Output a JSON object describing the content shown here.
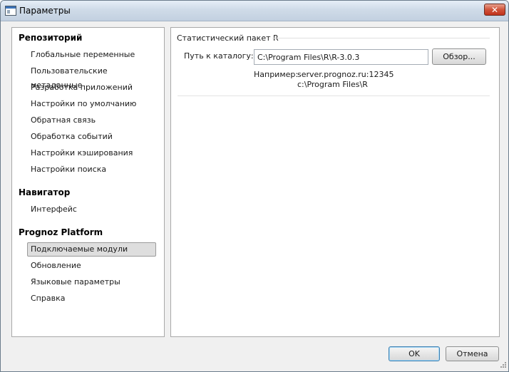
{
  "window": {
    "title": "Параметры",
    "close_glyph": "✕",
    "icon": "app-window-icon"
  },
  "sidebar": {
    "categories": [
      {
        "title": "Репозиторий",
        "items": [
          {
            "label": "Глобальные переменные"
          },
          {
            "label": "Пользовательские метаданные"
          },
          {
            "label": "Разработка приложений"
          },
          {
            "label": "Настройки по умолчанию"
          },
          {
            "label": "Обратная связь"
          },
          {
            "label": "Обработка событий"
          },
          {
            "label": "Настройки кэширования"
          },
          {
            "label": "Настройки поиска"
          }
        ]
      },
      {
        "title": "Навигатор",
        "items": [
          {
            "label": "Интерфейс"
          }
        ]
      },
      {
        "title": "Prognoz Platform",
        "items": [
          {
            "label": "Подключаемые модули",
            "selected": true
          },
          {
            "label": "Обновление"
          },
          {
            "label": "Языковые параметры"
          },
          {
            "label": "Справка"
          }
        ]
      }
    ]
  },
  "content": {
    "group_title": "Статистический пакет R",
    "path_label": "Путь к каталогу:",
    "path_value": "C:\\Program Files\\R\\R-3.0.3",
    "browse_label": "Обзор...",
    "example_label": "Например:",
    "example_lines": [
      "server.prognoz.ru:12345",
      "c:\\Program Files\\R"
    ]
  },
  "footer": {
    "ok_label": "OK",
    "cancel_label": "Отмена"
  },
  "colors": {
    "selected_bg": "#dedede",
    "close_red": "#c0321c",
    "default_button_border": "#3c7fb1"
  }
}
